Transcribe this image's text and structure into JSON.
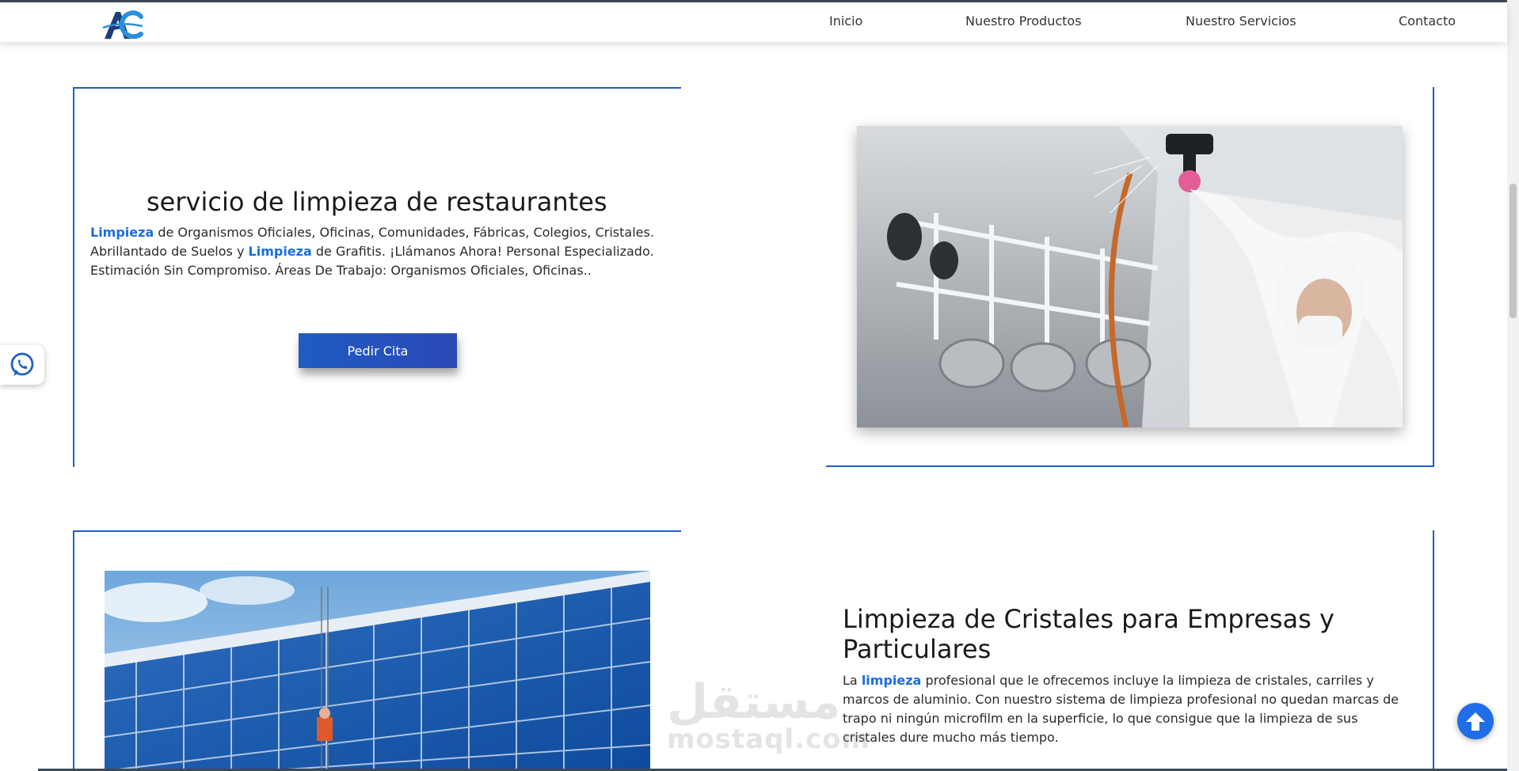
{
  "nav": {
    "logo_text": "AC",
    "items": [
      "Inicio",
      "Nuestro Productos",
      "Nuestro Servicios",
      "Contacto"
    ]
  },
  "section1": {
    "title": "servicio de limpieza de restaurantes",
    "line1_kw": "Limpieza",
    "line1_rest": " de Organismos Oficiales, Oficinas, Comunidades, Fábricas, Colegios, Cristales.",
    "line2_a": "Abrillantado de Suelos y ",
    "line2_kw": "Limpieza",
    "line2_b": " de Grafitis. ¡Llámanos Ahora! Personal Especializado.",
    "line3": "Estimación Sin Compromiso. Áreas De Trabajo: Organismos Oficiales, Oficinas..",
    "button_label": "Pedir Cita"
  },
  "section2": {
    "title_line1": "Limpieza de Cristales para Empresas y",
    "title_line2": "Particulares",
    "text_a": "La ",
    "text_kw": "limpieza",
    "text_b": " profesional que le ofrecemos incluye la limpieza de cristales, carriles y",
    "line2": "marcos de aluminio. Con nuestro sistema de limpieza profesional no quedan marcas de",
    "line3": "trapo ni ningún microfilm en la superficie, lo que consigue que la limpieza de sus",
    "line4": "cristales dure mucho más tiempo."
  },
  "watermark": {
    "word": "مستقل",
    "site": "mostaql.com"
  },
  "colors": {
    "accent": "#1e5fc9",
    "keyword": "#1a6de0",
    "button": "#1f5cc0",
    "scroll_up": "#1f6ee8"
  },
  "icons": [
    "whatsapp-icon",
    "arrow-up-icon"
  ]
}
